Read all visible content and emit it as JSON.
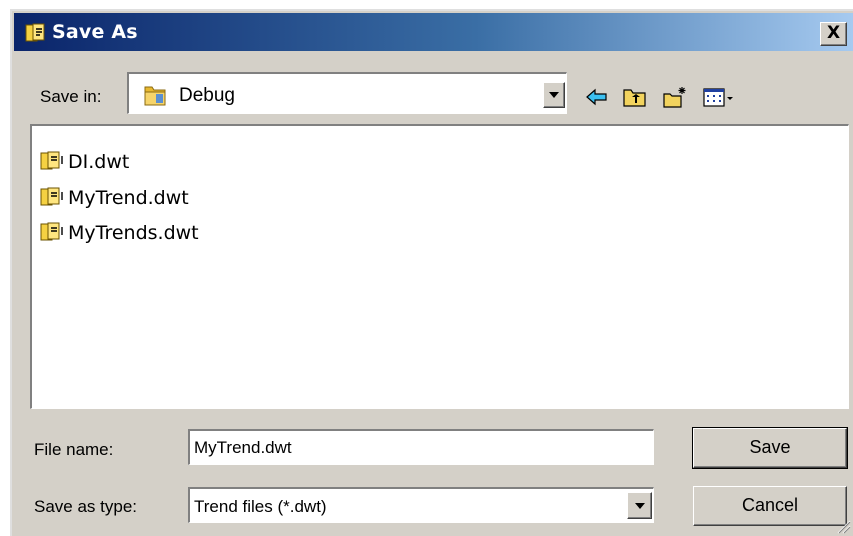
{
  "window": {
    "title": "Save As",
    "close_symbol": "X"
  },
  "toolbar": {
    "save_in_label": "Save in:",
    "save_in_value": "Debug",
    "icons": [
      "back-arrow-icon",
      "up-folder-icon",
      "new-folder-icon",
      "view-menu-icon"
    ]
  },
  "files": [
    {
      "name": "DI.dwt",
      "icon": "trend-file-icon"
    },
    {
      "name": "MyTrend.dwt",
      "icon": "trend-file-icon"
    },
    {
      "name": "MyTrends.dwt",
      "icon": "trend-file-icon"
    }
  ],
  "form": {
    "file_name_label": "File name:",
    "file_name_value": "MyTrend.dwt",
    "save_as_type_label": "Save as type:",
    "save_as_type_value": "Trend files (*.dwt)"
  },
  "buttons": {
    "save": "Save",
    "cancel": "Cancel"
  },
  "colors": {
    "title_gradient_start": "#0a246a",
    "title_gradient_end": "#a6caf0",
    "face": "#d4d0c8",
    "folder": "#f2c94c"
  }
}
